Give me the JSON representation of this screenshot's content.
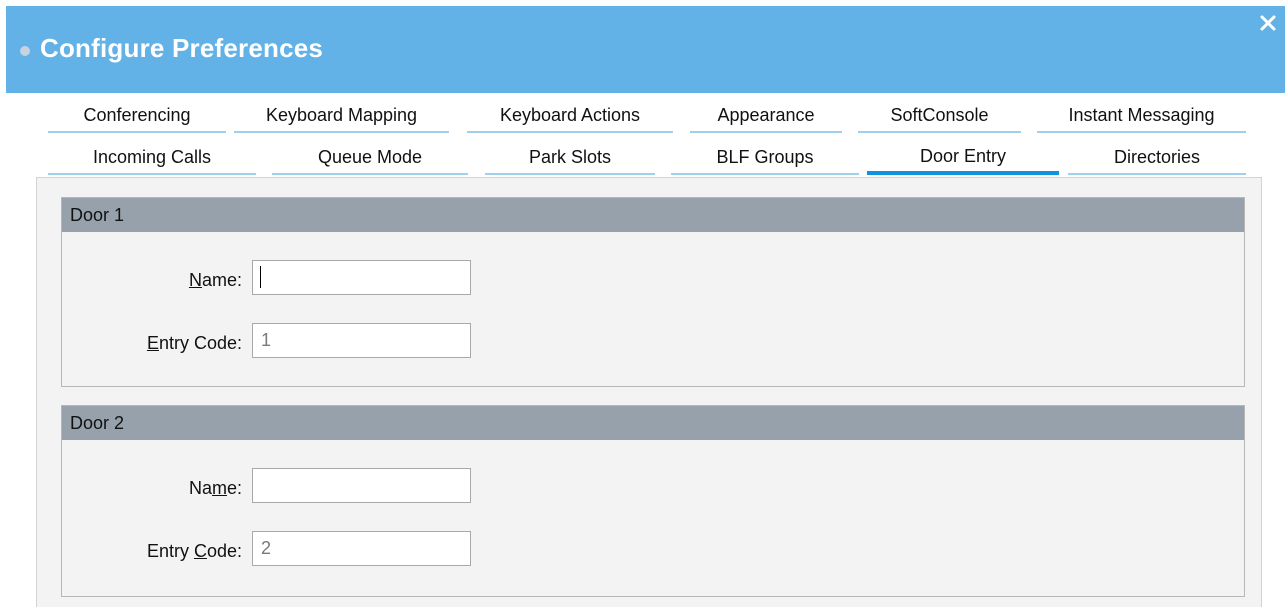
{
  "dialog": {
    "title": "Configure Preferences",
    "close_label": "×"
  },
  "tabs": {
    "row1": [
      "Conferencing",
      "Keyboard Mapping",
      "Keyboard Actions",
      "Appearance",
      "SoftConsole",
      "Instant Messaging"
    ],
    "row2": [
      "Incoming Calls",
      "Queue Mode",
      "Park Slots",
      "BLF Groups",
      "Door Entry",
      "Directories"
    ],
    "active": "Door Entry"
  },
  "doors": [
    {
      "header": "Door 1",
      "name_label_pre": "",
      "name_label_mnemonic": "N",
      "name_label_post": "ame:",
      "name_value": "",
      "entry_label_pre": "",
      "entry_label_mnemonic": "E",
      "entry_label_post": "ntry Code:",
      "entry_value": "1"
    },
    {
      "header": "Door 2",
      "name_label_pre": "Na",
      "name_label_mnemonic": "m",
      "name_label_post": "e:",
      "name_value": "",
      "entry_label_pre": "Entry ",
      "entry_label_mnemonic": "C",
      "entry_label_post": "ode:",
      "entry_value": "2"
    }
  ],
  "colors": {
    "titlebar": "#62b2e8",
    "active_tab_underline": "#0d94e0",
    "group_header": "#97a1ab"
  }
}
